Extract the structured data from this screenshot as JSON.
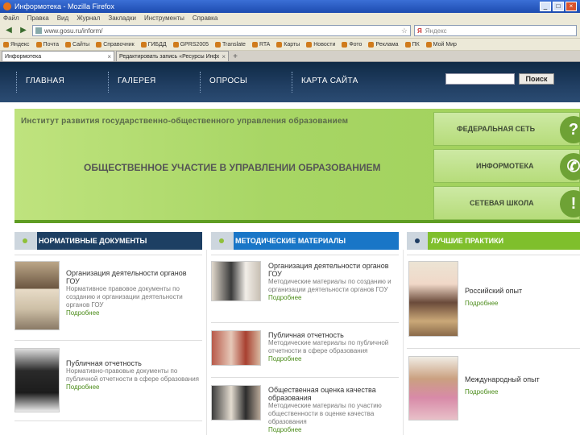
{
  "browser": {
    "title": "Информотека - Mozilla Firefox",
    "menu": [
      "Файл",
      "Правка",
      "Вид",
      "Журнал",
      "Закладки",
      "Инструменты",
      "Справка"
    ],
    "url": "www.gosu.ru/inform/",
    "search_placeholder": "Яндекс",
    "bookmarks": [
      "Яндекс",
      "Почта",
      "Сайты",
      "Справочник",
      "ГИБДД",
      "GPRS2005",
      "Translate",
      "RTA",
      "Карты",
      "Новости",
      "Фото",
      "Реклама",
      "ПК",
      "Мой Мир"
    ],
    "tabs": [
      {
        "label": "Информотека",
        "active": true
      },
      {
        "label": "Редактировать запись «Ресурсы ИнформМ»",
        "active": false
      }
    ]
  },
  "site": {
    "nav": [
      "ГЛАВНАЯ",
      "ГАЛЕРЕЯ",
      "ОПРОСЫ",
      "КАРТА САЙТА"
    ],
    "search_button": "Поиск",
    "banner": {
      "institute": "Институт развития государственно-общественного управления образованием",
      "headline": "ОБЩЕСТВЕННОЕ УЧАСТИЕ В УПРАВЛЕНИИ ОБРАЗОВАНИЕМ",
      "links": [
        "ФЕДЕРАЛЬНАЯ СЕТЬ",
        "ИНФОРМОТЕКА",
        "СЕТЕВАЯ ШКОЛА"
      ]
    },
    "columns": [
      {
        "title": "НОРМАТИВНЫЕ ДОКУМЕНТЫ",
        "items": [
          {
            "title": "Организация деятельности органов ГОУ",
            "desc": "Нормативное правовое документы по созданию и организации деятельности органов ГОУ",
            "more": "Подробнее"
          },
          {
            "title": "Публичная отчетность",
            "desc": "Нормативно-правовые документы по публичной отчетности в сфере образования",
            "more": "Подробнее"
          }
        ]
      },
      {
        "title": "МЕТОДИЧЕСКИЕ МАТЕРИАЛЫ",
        "items": [
          {
            "title": "Организация деятельности органов ГОУ",
            "desc": "Методические материалы по созданию и организации деятельности органов ГОУ",
            "more": "Подробнее"
          },
          {
            "title": "Публичная отчетность",
            "desc": "Методические материалы по публичной отчетности в сфере образования",
            "more": "Подробнее"
          },
          {
            "title": "Общественная оценка качества образования",
            "desc": "Методические материалы по участию общественности в оценке качества образования",
            "more": "Подробнее"
          }
        ]
      },
      {
        "title": "ЛУЧШИЕ ПРАКТИКИ",
        "items": [
          {
            "title": "Российский опыт",
            "more": "Подробнее"
          },
          {
            "title": "Международный опыт",
            "more": "Подробнее"
          }
        ]
      }
    ]
  }
}
